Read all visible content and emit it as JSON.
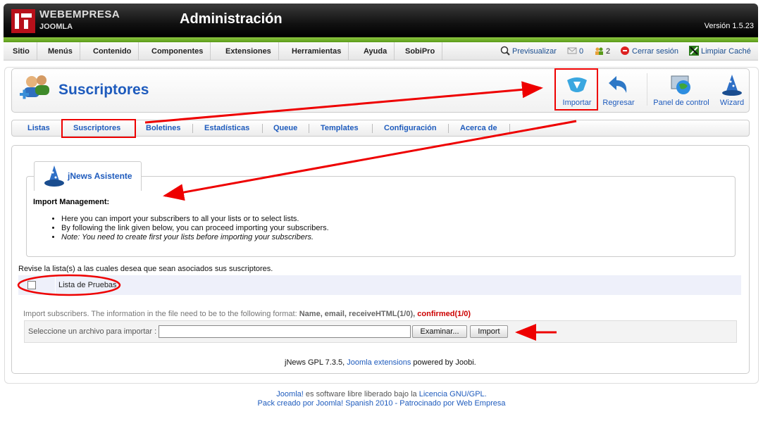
{
  "header": {
    "brand_line1": "WEBEMPRESA",
    "brand_line2": "JOOMLA",
    "title": "Administración",
    "version": "Versión 1.5.23"
  },
  "menu": {
    "items": [
      "Sitio",
      "Menús",
      "Contenido",
      "Componentes",
      "Extensiones",
      "Herramientas",
      "Ayuda",
      "SobiPro"
    ],
    "status": {
      "preview": "Previsualizar",
      "messages_count": "0",
      "users_count": "2",
      "logout": "Cerrar sesión",
      "clear_cache": "Limpiar Caché"
    }
  },
  "toolbar": {
    "page_title": "Suscriptores",
    "buttons": [
      "Importar",
      "Regresar",
      "Panel de control",
      "Wizard"
    ]
  },
  "submenu": {
    "items": [
      "Listas",
      "Suscriptores",
      "Boletines",
      "Estadísticas",
      "Queue",
      "Templates",
      "Configuración",
      "Acerca de"
    ],
    "active": "Suscriptores"
  },
  "wizard": {
    "tab_title": "jNews Asistente",
    "heading": "Import Management:",
    "bullets": [
      "Here you can import your subscribers to all your lists or to select lists.",
      "By following the link given below, you can proceed importing your subscribers.",
      "Note: You need to create first your lists before importing your subscribers."
    ]
  },
  "lists": {
    "prompt": "Revise la lista(s) a las cuales desea que sean asociados sus suscriptores.",
    "rows": [
      {
        "label": "Lista de Pruebas",
        "checked": false
      }
    ]
  },
  "import": {
    "info_text": "Import subscribers. The information in the file need to be to the following format:",
    "format_fields": "Name, email, receiveHTML(1/0),",
    "format_confirmed": "confirmed(1/0)",
    "file_label": "Seleccione un archivo para importar :",
    "browse_label": "Examinar...",
    "import_label": "Import"
  },
  "powered": {
    "prefix": "jNews GPL 7.3.5,",
    "link": "Joomla extensions",
    "suffix": "powered by Joobi."
  },
  "footer": {
    "line1_link1": "Joomla!",
    "line1_text": "es software libre liberado bajo la",
    "line1_link2": "Licencia GNU/GPL.",
    "line2": "Pack creado por Joomla! Spanish 2010 - Patrocinado por Web Empresa"
  },
  "colors": {
    "accent_blue": "#1e5bbd",
    "header_green": "#8cc63f",
    "annotation_red": "#e00000",
    "confirmed_red": "#cc0000"
  }
}
